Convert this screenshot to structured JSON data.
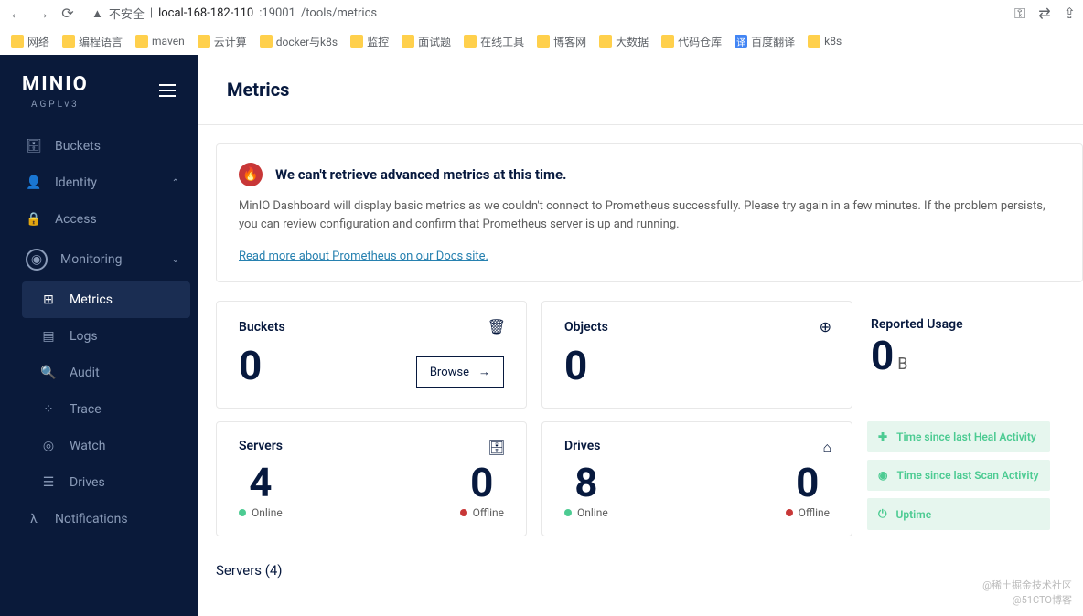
{
  "browser": {
    "security": "不安全",
    "host": "local-168-182-110",
    "port": ":19001",
    "path": "/tools/metrics"
  },
  "bookmarks": [
    "网络",
    "编程语言",
    "maven",
    "云计算",
    "docker与k8s",
    "监控",
    "面试题",
    "在线工具",
    "博客网",
    "大数据",
    "代码仓库",
    "百度翻译",
    "k8s"
  ],
  "logo": {
    "brand": "MINIO",
    "license": "AGPLv3"
  },
  "nav": {
    "buckets": "Buckets",
    "identity": "Identity",
    "access": "Access",
    "monitoring": "Monitoring",
    "metrics": "Metrics",
    "logs": "Logs",
    "audit": "Audit",
    "trace": "Trace",
    "watch": "Watch",
    "drives": "Drives",
    "notifications": "Notifications"
  },
  "page": {
    "title": "Metrics"
  },
  "alert": {
    "title": "We can't retrieve advanced metrics at this time.",
    "body": "MinIO Dashboard will display basic metrics as we couldn't connect to Prometheus successfully. Please try again in a few minutes. If the problem persists, you can review configuration and confirm that Prometheus server is up and running.",
    "link": "Read more about Prometheus on our Docs site."
  },
  "metrics": {
    "buckets": {
      "title": "Buckets",
      "value": "0",
      "browse": "Browse"
    },
    "objects": {
      "title": "Objects",
      "value": "0"
    },
    "usage": {
      "title": "Reported Usage",
      "value": "0",
      "unit": "B"
    },
    "servers": {
      "title": "Servers",
      "online": "4",
      "onlineLabel": "Online",
      "offline": "0",
      "offlineLabel": "Offline"
    },
    "drives": {
      "title": "Drives",
      "online": "8",
      "onlineLabel": "Online",
      "offline": "0",
      "offlineLabel": "Offline"
    },
    "heal": "Time since last Heal Activity",
    "scan": "Time since last Scan Activity",
    "uptime": "Uptime"
  },
  "serversHeader": "Servers (4)",
  "watermark": {
    "l1": "@稀土掘金技术社区",
    "l2": "@51CTO博客"
  }
}
